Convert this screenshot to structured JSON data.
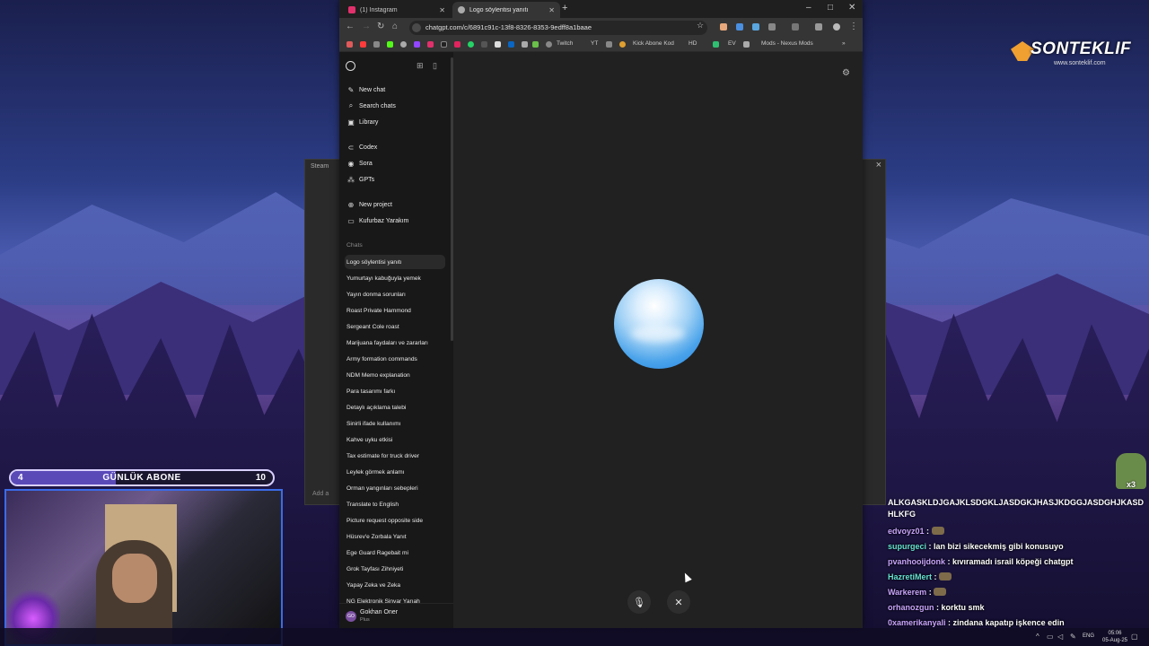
{
  "overlay": {
    "brand_title": "SONTEKLIF",
    "brand_sub": "www.sonteklif.com",
    "abone": {
      "current": "4",
      "label": "GÜNLÜK ABONE",
      "goal": "10",
      "progress": 0.4
    }
  },
  "back_window": {
    "tab": "Steam",
    "input_placeholder": "Add a"
  },
  "browser": {
    "tabs": [
      {
        "label": "(1) Instagram",
        "color": "#e1306c"
      },
      {
        "label": "Logo söylentisi yanıtı",
        "color": "#aaaaaa"
      }
    ],
    "url": "chatgpt.com/c/6891c91c-13f8-8326-8353-9edff8a1baae",
    "bookmarks": [
      "Twitch",
      "YT",
      "Kick Abone Kod",
      "HD",
      "EV",
      "Mods - Nexus Mods"
    ]
  },
  "sidebar": {
    "nav": [
      {
        "label": "New chat",
        "icon": "edit-icon"
      },
      {
        "label": "Search chats",
        "icon": "search-icon"
      },
      {
        "label": "Library",
        "icon": "library-icon"
      }
    ],
    "apps": [
      {
        "label": "Codex",
        "icon": "codex-icon"
      },
      {
        "label": "Sora",
        "icon": "sora-icon"
      },
      {
        "label": "GPTs",
        "icon": "gpts-icon"
      }
    ],
    "projects": [
      {
        "label": "New project",
        "icon": "folder-plus-icon"
      },
      {
        "label": "Kufurbaz Yarakım",
        "icon": "folder-icon"
      }
    ],
    "chats_header": "Chats",
    "chats": [
      "Logo söylentisi yanıtı",
      "Yumurtayı kabuğuyla yemek",
      "Yayın donma sorunları",
      "Roast Private Hammond",
      "Sergeant Cole roast",
      "Marijuana faydaları ve zararları",
      "Army formation commands",
      "NDM Memo explanation",
      "Para tasarımı farkı",
      "Detaylı açıklama talebi",
      "Sinirli ifade kullanımı",
      "Kahve uyku etkisi",
      "Tax estimate for truck driver",
      "Leylek görmek anlamı",
      "Orman yangınları sebepleri",
      "Translate to English",
      "Picture request opposite side",
      "Hüsrev'e Zorbala Yanıt",
      "Ege Guard Ragebait mi",
      "Grok Tayfası Zihniyeti",
      "Yapay Zeka ve Zeka",
      "NG Elektronik Sinyar Yarıah"
    ],
    "user": {
      "initials": "GO",
      "name": "Gokhan Oner",
      "plan": "Plus"
    }
  },
  "twitch_chat": {
    "long_message": "ALKGASKLDJGAJKLSDGKLJASDGKJHASJKDGGJASDGHJKASDHLKFG",
    "messages": [
      {
        "user": "edvoyz01",
        "text": "",
        "user_class": "purple",
        "emote": true
      },
      {
        "user": "supurgeci",
        "text": "lan bizi sikecekmiş gibi konusuyo",
        "user_class": "teal"
      },
      {
        "user": "pvanhooijdonk",
        "text": "kıvıramadı israil köpeği chatgpt",
        "user_class": "purple"
      },
      {
        "user": "HazretiMert",
        "text": "",
        "user_class": "teal",
        "emote": true
      },
      {
        "user": "Warkerem",
        "text": "",
        "user_class": "purple",
        "emote": true
      },
      {
        "user": "orhanozgun",
        "text": "korktu smk",
        "user_class": "purple"
      },
      {
        "user": "0xamerikanyali",
        "text": "zindana kapatıp işkence edin",
        "user_class": "purple"
      }
    ],
    "emote_count": "x3"
  },
  "taskbar": {
    "lang": "ENG",
    "time": "05:06",
    "date": "05-Aug-25"
  }
}
